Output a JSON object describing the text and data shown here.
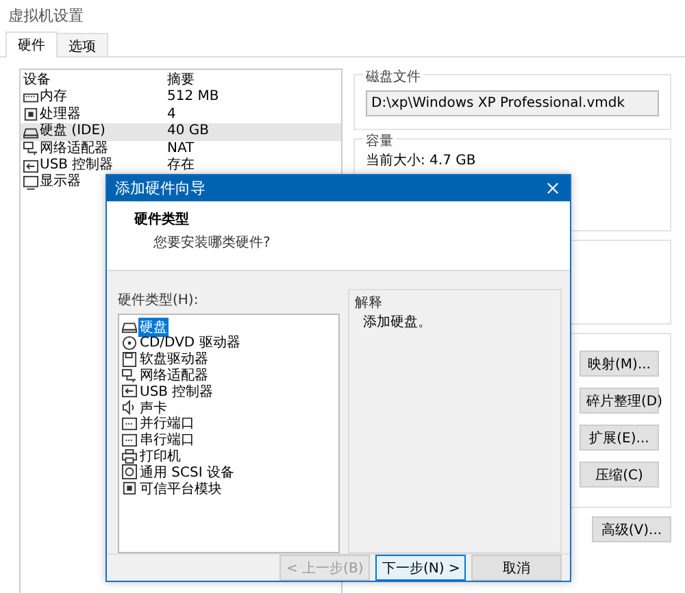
{
  "window": {
    "title": "虚拟机设置"
  },
  "tabs": [
    {
      "label": "硬件",
      "selected": true
    },
    {
      "label": "选项",
      "selected": false
    }
  ],
  "devices": {
    "columns": [
      "设备",
      "摘要"
    ],
    "rows": [
      {
        "kind": "memory",
        "name": "内存",
        "summary": "512 MB",
        "selected": false
      },
      {
        "kind": "cpu",
        "name": "处理器",
        "summary": "4",
        "selected": false
      },
      {
        "kind": "disk",
        "name": "硬盘 (IDE)",
        "summary": "40 GB",
        "selected": true
      },
      {
        "kind": "network",
        "name": "网络适配器",
        "summary": "NAT",
        "selected": false
      },
      {
        "kind": "usb",
        "name": "USB 控制器",
        "summary": "存在",
        "selected": false
      },
      {
        "kind": "display",
        "name": "显示器",
        "selected": false
      }
    ]
  },
  "disk_file": {
    "title": "磁盘文件",
    "value": "D:\\xp\\Windows XP Professional.vmdk"
  },
  "capacity": {
    "title": "容量",
    "current_size": "当前大小: 4.7 GB"
  },
  "disk_buttons": [
    "映射(M)...",
    "碎片整理(D)",
    "扩展(E)...",
    "压缩(C)"
  ],
  "advanced_button": "高级(V)...",
  "dialog": {
    "title": "添加硬件向导",
    "heading": "硬件类型",
    "subheading": "您要安装哪类硬件?",
    "list_label": "硬件类型(H):",
    "items": [
      {
        "kind": "disk",
        "label": "硬盘",
        "selected": true
      },
      {
        "kind": "cdrom",
        "label": "CD/DVD 驱动器",
        "selected": false
      },
      {
        "kind": "floppy",
        "label": "软盘驱动器",
        "selected": false
      },
      {
        "kind": "network",
        "label": "网络适配器",
        "selected": false
      },
      {
        "kind": "usb",
        "label": "USB 控制器",
        "selected": false
      },
      {
        "kind": "sound",
        "label": "声卡",
        "selected": false
      },
      {
        "kind": "parallel",
        "label": "并行端口",
        "selected": false
      },
      {
        "kind": "serial",
        "label": "串行端口",
        "selected": false
      },
      {
        "kind": "printer",
        "label": "打印机",
        "selected": false
      },
      {
        "kind": "scsi",
        "label": "通用 SCSI 设备",
        "selected": false
      },
      {
        "kind": "tpm",
        "label": "可信平台模块",
        "selected": false
      }
    ],
    "explain_title": "解释",
    "explain_text": "添加硬盘。",
    "buttons": [
      {
        "label": "< 上一步(B)",
        "disabled": true,
        "default": false
      },
      {
        "label": "下一步(N) >",
        "disabled": false,
        "default": true
      },
      {
        "label": "取消",
        "disabled": false,
        "default": false
      }
    ]
  }
}
